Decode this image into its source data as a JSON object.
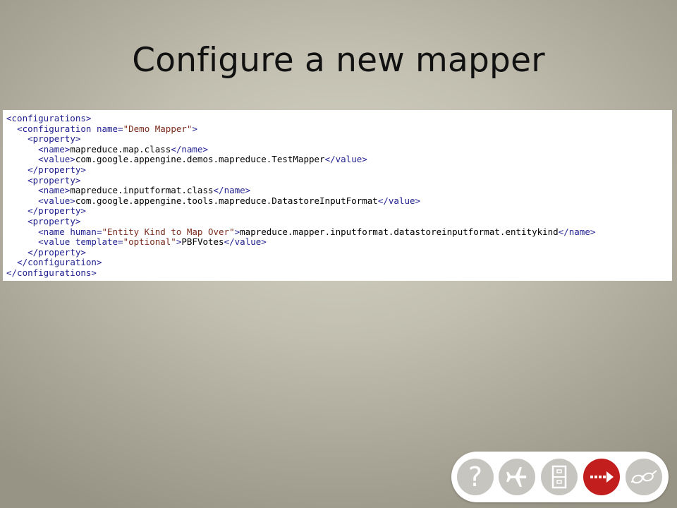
{
  "slide": {
    "title": "Configure a new mapper"
  },
  "code_lines": [
    [
      {
        "t": "tag",
        "v": "<configurations>"
      }
    ],
    [
      {
        "t": "txt",
        "v": "  "
      },
      {
        "t": "tag",
        "v": "<configuration "
      },
      {
        "t": "attr-name",
        "v": "name="
      },
      {
        "t": "attr-val",
        "v": "\"Demo Mapper\""
      },
      {
        "t": "tag",
        "v": ">"
      }
    ],
    [
      {
        "t": "txt",
        "v": "    "
      },
      {
        "t": "tag",
        "v": "<property>"
      }
    ],
    [
      {
        "t": "txt",
        "v": "      "
      },
      {
        "t": "tag",
        "v": "<name>"
      },
      {
        "t": "txt",
        "v": "mapreduce.map.class"
      },
      {
        "t": "tag",
        "v": "</name>"
      }
    ],
    [
      {
        "t": "txt",
        "v": "      "
      },
      {
        "t": "tag",
        "v": "<value>"
      },
      {
        "t": "txt",
        "v": "com.google.appengine.demos.mapreduce.TestMapper"
      },
      {
        "t": "tag",
        "v": "</value>"
      }
    ],
    [
      {
        "t": "txt",
        "v": "    "
      },
      {
        "t": "tag",
        "v": "</property>"
      }
    ],
    [
      {
        "t": "txt",
        "v": "    "
      },
      {
        "t": "tag",
        "v": "<property>"
      }
    ],
    [
      {
        "t": "txt",
        "v": "      "
      },
      {
        "t": "tag",
        "v": "<name>"
      },
      {
        "t": "txt",
        "v": "mapreduce.inputformat.class"
      },
      {
        "t": "tag",
        "v": "</name>"
      }
    ],
    [
      {
        "t": "txt",
        "v": "      "
      },
      {
        "t": "tag",
        "v": "<value>"
      },
      {
        "t": "txt",
        "v": "com.google.appengine.tools.mapreduce.DatastoreInputFormat"
      },
      {
        "t": "tag",
        "v": "</value>"
      }
    ],
    [
      {
        "t": "txt",
        "v": "    "
      },
      {
        "t": "tag",
        "v": "</property>"
      }
    ],
    [
      {
        "t": "txt",
        "v": "    "
      },
      {
        "t": "tag",
        "v": "<property>"
      }
    ],
    [
      {
        "t": "txt",
        "v": "      "
      },
      {
        "t": "tag",
        "v": "<name "
      },
      {
        "t": "attr-name",
        "v": "human="
      },
      {
        "t": "attr-val",
        "v": "\"Entity Kind to Map Over\""
      },
      {
        "t": "tag",
        "v": ">"
      },
      {
        "t": "txt",
        "v": "mapreduce.mapper.inputformat.datastoreinputformat.entitykind"
      },
      {
        "t": "tag",
        "v": "</name>"
      }
    ],
    [
      {
        "t": "txt",
        "v": "      "
      },
      {
        "t": "tag",
        "v": "<value "
      },
      {
        "t": "attr-name",
        "v": "template="
      },
      {
        "t": "attr-val",
        "v": "\"optional\""
      },
      {
        "t": "tag",
        "v": ">"
      },
      {
        "t": "txt",
        "v": "PBFVotes"
      },
      {
        "t": "tag",
        "v": "</value>"
      }
    ],
    [
      {
        "t": "txt",
        "v": "    "
      },
      {
        "t": "tag",
        "v": "</property>"
      }
    ],
    [
      {
        "t": "txt",
        "v": "  "
      },
      {
        "t": "tag",
        "v": "</configuration>"
      }
    ],
    [
      {
        "t": "tag",
        "v": "</configurations>"
      }
    ]
  ],
  "nav": {
    "buttons": [
      {
        "name": "help-button",
        "icon": "question-mark-icon",
        "label": "?"
      },
      {
        "name": "airplane-button",
        "icon": "airplane-icon"
      },
      {
        "name": "cabinet-button",
        "icon": "file-cabinet-icon"
      },
      {
        "name": "next-button",
        "icon": "dotted-arrow-right-icon",
        "active": true
      },
      {
        "name": "glasses-button",
        "icon": "eyeglasses-icon"
      }
    ],
    "active_color": "#c21e1e",
    "inactive_color": "#c6c5c0"
  }
}
